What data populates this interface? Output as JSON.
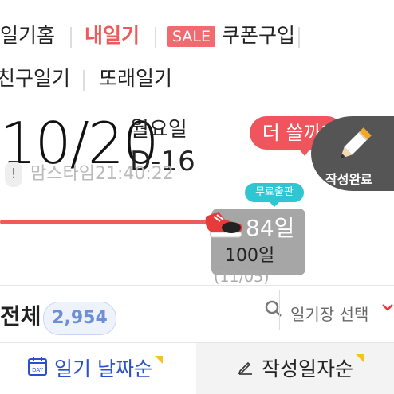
{
  "nav": {
    "home": "일기홈",
    "mine": "내일기",
    "sale_badge": "SALE",
    "coupon": "쿠폰구입",
    "friends": "친구일기",
    "peers": "또래일기"
  },
  "today": {
    "date": "10/20",
    "weekday": "월요일",
    "dday": "D-16",
    "alert_icon": "!",
    "mood_text": "맘스타임21:40:22"
  },
  "write": {
    "bubble": "더 쓸까?",
    "done_label": "작성완료",
    "icon": "pencil-icon"
  },
  "progress": {
    "badge": "무료출판",
    "current_days": "84일",
    "goal_days": "100일",
    "goal_date": "(11/05)",
    "fraction": 0.84,
    "bar_color": "#ef5a5a"
  },
  "list": {
    "all_label": "전체",
    "count": "2,954",
    "select_label": "일기장 선택"
  },
  "tabs": {
    "by_date": "일기 날짜순",
    "by_written": "작성일자순",
    "active": "by_date"
  },
  "colors": {
    "accent": "#f0595a",
    "sale": "#f26a6d",
    "teal": "#2fc6d1",
    "blue": "#2a4fd0"
  }
}
